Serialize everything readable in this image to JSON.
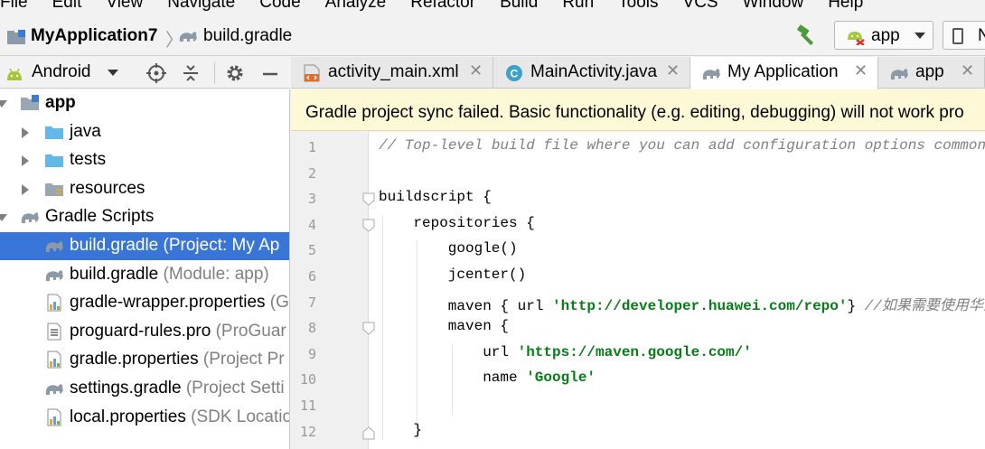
{
  "menu": [
    "File",
    "Edit",
    "View",
    "Navigate",
    "Code",
    "Analyze",
    "Refactor",
    "Build",
    "Run",
    "Tools",
    "VCS",
    "Window",
    "Help"
  ],
  "navbar": {
    "project": "MyApplication7",
    "file": "build.gradle",
    "run_config": "app",
    "device_label": "N"
  },
  "project_panel": {
    "view_mode": "Android",
    "items": [
      {
        "label": "app",
        "hint": "",
        "level": 0,
        "expanded": true,
        "icon": "module-folder-icon",
        "bold": true
      },
      {
        "label": "java",
        "hint": "",
        "level": 1,
        "expanded": false,
        "icon": "folder-icon"
      },
      {
        "label": "tests",
        "hint": "",
        "level": 1,
        "expanded": false,
        "icon": "folder-icon"
      },
      {
        "label": "resources",
        "hint": "",
        "level": 1,
        "expanded": false,
        "icon": "resources-folder-icon"
      },
      {
        "label": "Gradle Scripts",
        "hint": "",
        "level": 0,
        "expanded": true,
        "icon": "gradle-icon"
      },
      {
        "label": "build.gradle",
        "hint": " (Project: My Ap",
        "level": 1,
        "icon": "gradle-icon",
        "selected": true
      },
      {
        "label": "build.gradle",
        "hint": " (Module: app)",
        "level": 1,
        "icon": "gradle-icon"
      },
      {
        "label": "gradle-wrapper.properties",
        "hint": " (G",
        "level": 1,
        "icon": "properties-file-icon"
      },
      {
        "label": "proguard-rules.pro",
        "hint": " (ProGuar",
        "level": 1,
        "icon": "text-file-icon"
      },
      {
        "label": "gradle.properties",
        "hint": " (Project Pr",
        "level": 1,
        "icon": "properties-file-icon"
      },
      {
        "label": "settings.gradle",
        "hint": " (Project Setti",
        "level": 1,
        "icon": "gradle-icon"
      },
      {
        "label": "local.properties",
        "hint": " (SDK Locatio",
        "level": 1,
        "icon": "properties-file-icon"
      }
    ]
  },
  "tabs": [
    {
      "label": "activity_main.xml",
      "icon": "xml-file-icon",
      "active": false
    },
    {
      "label": "MainActivity.java",
      "icon": "java-class-icon",
      "active": false
    },
    {
      "label": "My Application",
      "icon": "gradle-icon",
      "active": true
    },
    {
      "label": "app",
      "icon": "gradle-icon",
      "active": false
    }
  ],
  "banner": "Gradle project sync failed. Basic functionality (e.g. editing, debugging) will not work pro",
  "editor": {
    "line_numbers": [
      "1",
      "2",
      "3",
      "4",
      "5",
      "6",
      "7",
      "8",
      "9",
      "10",
      "11",
      "12"
    ],
    "lines": [
      {
        "indent": 0,
        "parts": [
          {
            "t": "// Top-level build file where you can add configuration options common to a",
            "c": "cmt"
          }
        ]
      },
      {
        "indent": 0,
        "parts": []
      },
      {
        "indent": 0,
        "parts": [
          {
            "t": "buildscript {",
            "c": ""
          }
        ]
      },
      {
        "indent": 1,
        "parts": [
          {
            "t": "repositories {",
            "c": ""
          }
        ]
      },
      {
        "indent": 2,
        "parts": [
          {
            "t": "google()",
            "c": ""
          }
        ]
      },
      {
        "indent": 2,
        "parts": [
          {
            "t": "jcenter()",
            "c": ""
          }
        ]
      },
      {
        "indent": 2,
        "parts": [
          {
            "t": "maven { url ",
            "c": ""
          },
          {
            "t": "'http://developer.huawei.com/repo'",
            "c": "str"
          },
          {
            "t": "} ",
            "c": ""
          },
          {
            "t": "//如果需要使用华为推",
            "c": "cmt"
          }
        ]
      },
      {
        "indent": 2,
        "parts": [
          {
            "t": "maven {",
            "c": ""
          }
        ]
      },
      {
        "indent": 3,
        "parts": [
          {
            "t": "url ",
            "c": ""
          },
          {
            "t": "'https://maven.google.com/'",
            "c": "str"
          }
        ]
      },
      {
        "indent": 3,
        "parts": [
          {
            "t": "name ",
            "c": ""
          },
          {
            "t": "'Google'",
            "c": "str"
          }
        ]
      },
      {
        "indent": 0,
        "parts": []
      },
      {
        "indent": 1,
        "parts": [
          {
            "t": "}",
            "c": ""
          }
        ]
      }
    ]
  },
  "colors": {
    "selection": "#3875d7",
    "banner_bg": "#fdf8d6",
    "string": "#067d17",
    "comment": "#808080",
    "android_green": "#a4c639",
    "folder_blue": "#62b8e6"
  }
}
